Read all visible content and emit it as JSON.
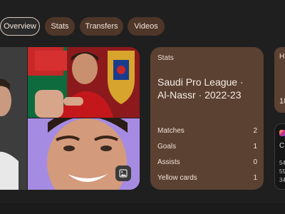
{
  "chips": [
    {
      "label": "Overview",
      "selected": true
    },
    {
      "label": "Stats",
      "selected": false
    },
    {
      "label": "Transfers",
      "selected": false
    },
    {
      "label": "Videos",
      "selected": false
    }
  ],
  "stats_card": {
    "header": "Stats",
    "title": "Saudi Pro League · Al-Nassr · 2022-23",
    "rows": [
      {
        "label": "Matches",
        "value": "2"
      },
      {
        "label": "Goals",
        "value": "1"
      },
      {
        "label": "Assists",
        "value": "0"
      },
      {
        "label": "Yellow cards",
        "value": "1"
      }
    ]
  },
  "history_card": {
    "label_partial": "H",
    "value_partial": "18"
  },
  "social_card": {
    "label_partial": "C",
    "lines_partial": [
      "54",
      "55",
      "34"
    ]
  },
  "colors": {
    "chip_bg": "#4e3629",
    "card_bg": "#5b4131",
    "page_bg": "#1f1f1f"
  }
}
